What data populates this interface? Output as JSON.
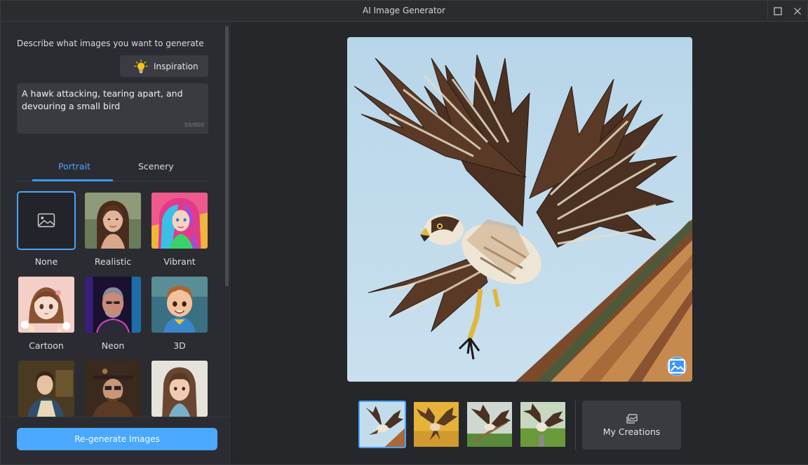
{
  "window": {
    "title": "AI Image Generator"
  },
  "left": {
    "describe_label": "Describe what images you want to generate",
    "inspiration_label": "Inspiration",
    "prompt_text": "A hawk attacking, tearing apart, and devouring a small bird",
    "prompt_counter": "59/800",
    "tabs": [
      {
        "label": "Portrait",
        "active": true
      },
      {
        "label": "Scenery",
        "active": false
      }
    ],
    "styles": [
      {
        "label": "None",
        "selected": true
      },
      {
        "label": "Realistic",
        "selected": false
      },
      {
        "label": "Vibrant",
        "selected": false
      },
      {
        "label": "Cartoon",
        "selected": false
      },
      {
        "label": "Neon",
        "selected": false
      },
      {
        "label": "3D",
        "selected": false
      },
      {
        "label": "",
        "selected": false
      },
      {
        "label": "",
        "selected": false
      },
      {
        "label": "",
        "selected": false
      }
    ],
    "regenerate_label": "Re-generate Images"
  },
  "main": {
    "thumbnails": [
      {
        "selected": true
      },
      {
        "selected": false
      },
      {
        "selected": false
      },
      {
        "selected": false
      }
    ],
    "my_creations_label": "My Creations"
  },
  "colors": {
    "accent": "#4aa3ff",
    "button_primary": "#4aa8ff",
    "panel": "#2b2c31",
    "background": "#26272b"
  },
  "icons": [
    "maximize-icon",
    "close-icon",
    "lightbulb-icon",
    "image-placeholder-icon",
    "gallery-icon",
    "image-badge-icon"
  ]
}
